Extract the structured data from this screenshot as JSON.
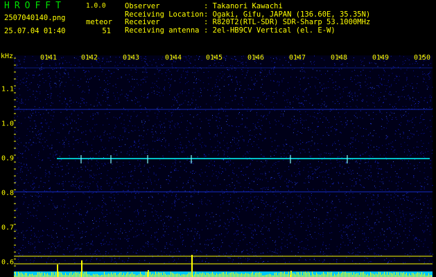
{
  "header": {
    "logo": "HROFFT",
    "version": "1.0.0",
    "filename": "2507040140.png",
    "timestamp": "25.07.04 01:40",
    "meteor_label": "meteor",
    "meteor_count": "51"
  },
  "info": [
    {
      "label": "Observer",
      "value": "Takanori Kawachi"
    },
    {
      "label": "Receiving Location",
      "value": "Ogaki, Gifu, JAPAN (136.60E, 35.35N)"
    },
    {
      "label": "Receiver",
      "value": "R820T2(RTL-SDR) SDR-Sharp 53.1000MHz"
    },
    {
      "label": "Receiving antenna",
      "value": "2el-HB9CV Vertical (el. E-W)"
    }
  ],
  "axis": {
    "y_unit": "kHz",
    "y_labels": [
      "1.1",
      "1.0",
      "0.9",
      "0.8",
      "0.7",
      "0.6"
    ],
    "time_labels": [
      "0141",
      "0142",
      "0143",
      "0144",
      "0145",
      "0146",
      "0147",
      "0148",
      "0149",
      "0150"
    ]
  },
  "colors": {
    "background": "#000000",
    "noise_base": "#00008c",
    "carrier_line": "#00ffff",
    "text": "#ffff00",
    "logo": "#00e000",
    "amplitude": "#ffff00"
  }
}
